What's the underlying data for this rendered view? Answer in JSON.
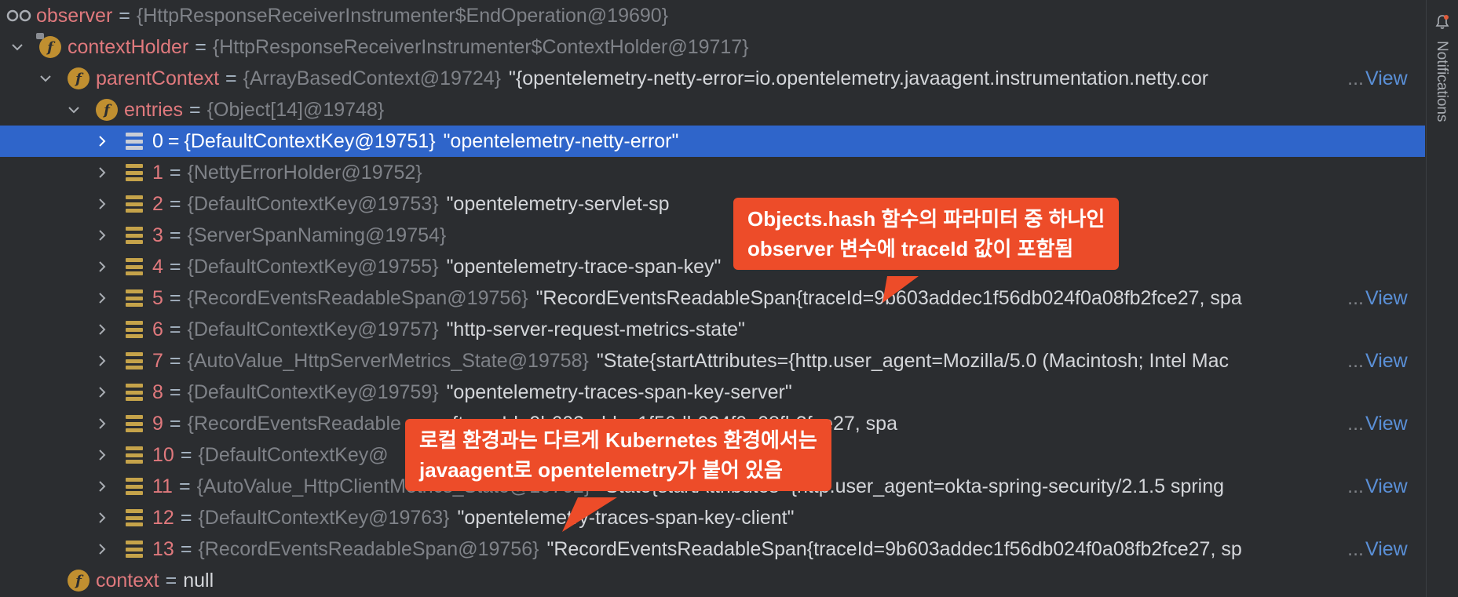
{
  "debugger": {
    "rows": [
      {
        "kind": "watch",
        "name": "observer",
        "eq": "=",
        "obj": "{HttpResponseReceiverInstrumenter$EndOperation@19690}"
      },
      {
        "kind": "field",
        "expanded": true,
        "name": "contextHolder",
        "eq": "=",
        "obj": "{HttpResponseReceiverInstrumenter$ContextHolder@19717}"
      },
      {
        "kind": "field",
        "expanded": true,
        "name": "parentContext",
        "eq": "=",
        "obj": "{ArrayBasedContext@19724}",
        "str": "\"{opentelemetry-netty-error=io.opentelemetry.javaagent.instrumentation.netty.cor",
        "ellipsis": "...",
        "view": "View"
      },
      {
        "kind": "field",
        "expanded": true,
        "name": "entries",
        "eq": "=",
        "obj": "{Object[14]@19748}"
      },
      {
        "kind": "entry",
        "index": "0",
        "eq": "=",
        "obj": "{DefaultContextKey@19751}",
        "str": "\"opentelemetry-netty-error\"",
        "selected": true
      },
      {
        "kind": "entry",
        "index": "1",
        "eq": "=",
        "obj": "{NettyErrorHolder@19752}"
      },
      {
        "kind": "entry",
        "index": "2",
        "eq": "=",
        "obj": "{DefaultContextKey@19753}",
        "str": "\"opentelemetry-servlet-sp"
      },
      {
        "kind": "entry",
        "index": "3",
        "eq": "=",
        "obj": "{ServerSpanNaming@19754}"
      },
      {
        "kind": "entry",
        "index": "4",
        "eq": "=",
        "obj": "{DefaultContextKey@19755}",
        "str": "\"opentelemetry-trace-span-key\""
      },
      {
        "kind": "entry",
        "index": "5",
        "eq": "=",
        "obj": "{RecordEventsReadableSpan@19756}",
        "str": "\"RecordEventsReadableSpan{traceId=9b603addec1f56db024f0a08fb2fce27, spa",
        "ellipsis": "...",
        "view": "View"
      },
      {
        "kind": "entry",
        "index": "6",
        "eq": "=",
        "obj": "{DefaultContextKey@19757}",
        "str": "\"http-server-request-metrics-state\""
      },
      {
        "kind": "entry",
        "index": "7",
        "eq": "=",
        "obj": "{AutoValue_HttpServerMetrics_State@19758}",
        "str": "\"State{startAttributes={http.user_agent=Mozilla/5.0 (Macintosh; Intel Mac",
        "ellipsis": "...",
        "view": "View"
      },
      {
        "kind": "entry",
        "index": "8",
        "eq": "=",
        "obj": "{DefaultContextKey@19759}",
        "str": "\"opentelemetry-traces-span-key-server\""
      },
      {
        "kind": "entry",
        "index": "9",
        "eq": "=",
        "obj": "{RecordEventsReadable",
        "str": "span{traceId=9b603addec1f56db024f0a08fb2fce27, spa",
        "ellipsis": "...",
        "view": "View"
      },
      {
        "kind": "entry",
        "index": "10",
        "eq": "=",
        "obj": "{DefaultContextKey@"
      },
      {
        "kind": "entry",
        "index": "11",
        "eq": "=",
        "obj": "{AutoValue_HttpClientMetrics_State@19762}",
        "str": "\"State{startAttributes={http.user_agent=okta-spring-security/2.1.5 spring",
        "ellipsis": "...",
        "view": "View"
      },
      {
        "kind": "entry",
        "index": "12",
        "eq": "=",
        "obj": "{DefaultContextKey@19763}",
        "str": "\"opentelemetry-traces-span-key-client\""
      },
      {
        "kind": "entry",
        "index": "13",
        "eq": "=",
        "obj": "{RecordEventsReadableSpan@19756}",
        "str": "\"RecordEventsReadableSpan{traceId=9b603addec1f56db024f0a08fb2fce27, sp",
        "ellipsis": "...",
        "view": "View"
      },
      {
        "kind": "field",
        "name": "context",
        "eq": "=",
        "null": "null"
      }
    ]
  },
  "sidebar": {
    "notifications_label": "Notifications",
    "icon": "bell-icon"
  },
  "callouts": {
    "top": {
      "line1": "Objects.hash 함수의 파라미터 중 하나인",
      "line2": "observer 변수에 traceId 값이 포함됨"
    },
    "bottom": {
      "line1": "로컬 환경과는 다르게 Kubernetes 환경에서는",
      "line2": "javaagent로 opentelemetry가 붙어 있음"
    }
  },
  "colors": {
    "background": "#2b2d30",
    "selection": "#2f65ca",
    "field_name": "#e0797d",
    "object_ref": "#7f8288",
    "string_value": "#d4d6da",
    "link": "#5a8fd6",
    "callout": "#ed4c29"
  }
}
